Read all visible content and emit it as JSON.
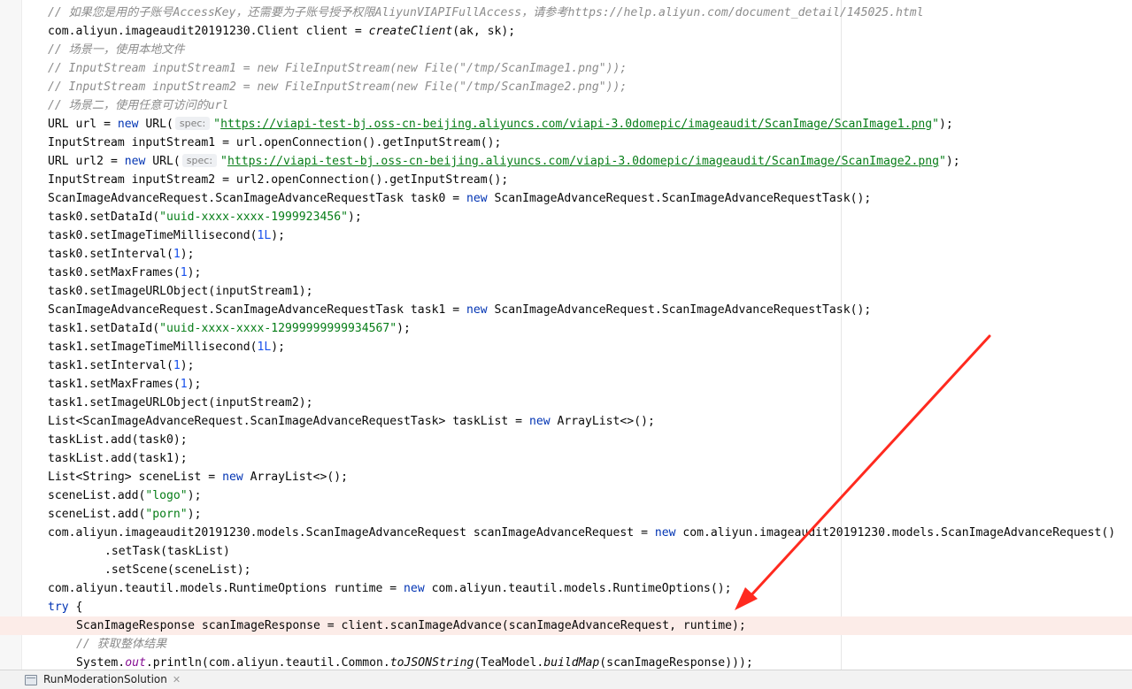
{
  "editor": {
    "lines": {
      "l0": {
        "comment": "// 如果您是用的子账号AccessKey，还需要为子账号授予权限AliyunVIAPIFullAccess，请参考https://help.aliyun.com/document_detail/145025.html"
      },
      "l1": {
        "prefix": "com.aliyun.imageaudit20191230.Client client = ",
        "method": "createClient",
        "suffix": "(ak, sk);"
      },
      "l2": {
        "comment": "// 场景一，使用本地文件"
      },
      "l3": {
        "comment": "// InputStream inputStream1 = new FileInputStream(new File(\"/tmp/ScanImage1.png\"));"
      },
      "l4": {
        "comment": "// InputStream inputStream2 = new FileInputStream(new File(\"/tmp/ScanImage2.png\"));"
      },
      "l5": {
        "comment": "// 场景二，使用任意可访问的url"
      },
      "l6": {
        "prefix": "URL url = ",
        "kw": "new",
        "mid": " URL(",
        "hint": "spec:",
        "q1": "\"",
        "url": "https://viapi-test-bj.oss-cn-beijing.aliyuncs.com/viapi-3.0domepic/imageaudit/ScanImage/ScanImage1.png",
        "q2": "\"",
        "suffix": ");"
      },
      "l7": {
        "text": "InputStream inputStream1 = url.openConnection().getInputStream();"
      },
      "l8": {
        "prefix": "URL url2 = ",
        "kw": "new",
        "mid": " URL(",
        "hint": "spec:",
        "q1": "\"",
        "url": "https://viapi-test-bj.oss-cn-beijing.aliyuncs.com/viapi-3.0domepic/imageaudit/ScanImage/ScanImage2.png",
        "q2": "\"",
        "suffix": ");"
      },
      "l9": {
        "text": "InputStream inputStream2 = url2.openConnection().getInputStream();"
      },
      "l10": {
        "prefix": "ScanImageAdvanceRequest.ScanImageAdvanceRequestTask task0 = ",
        "kw": "new",
        "suffix": " ScanImageAdvanceRequest.ScanImageAdvanceRequestTask();"
      },
      "l11": {
        "prefix": "task0.setDataId(",
        "str": "\"uuid-xxxx-xxxx-1999923456\"",
        "suffix": ");"
      },
      "l12": {
        "prefix": "task0.setImageTimeMillisecond(",
        "num": "1L",
        "suffix": ");"
      },
      "l13": {
        "prefix": "task0.setInterval(",
        "num": "1",
        "suffix": ");"
      },
      "l14": {
        "prefix": "task0.setMaxFrames(",
        "num": "1",
        "suffix": ");"
      },
      "l15": {
        "text": "task0.setImageURLObject(inputStream1);"
      },
      "l16": {
        "prefix": "ScanImageAdvanceRequest.ScanImageAdvanceRequestTask task1 = ",
        "kw": "new",
        "suffix": " ScanImageAdvanceRequest.ScanImageAdvanceRequestTask();"
      },
      "l17": {
        "prefix": "task1.setDataId(",
        "str": "\"uuid-xxxx-xxxx-12999999999934567\"",
        "suffix": ");"
      },
      "l18": {
        "prefix": "task1.setImageTimeMillisecond(",
        "num": "1L",
        "suffix": ");"
      },
      "l19": {
        "prefix": "task1.setInterval(",
        "num": "1",
        "suffix": ");"
      },
      "l20": {
        "prefix": "task1.setMaxFrames(",
        "num": "1",
        "suffix": ");"
      },
      "l21": {
        "text": "task1.setImageURLObject(inputStream2);"
      },
      "l22": {
        "prefix": "List<ScanImageAdvanceRequest.ScanImageAdvanceRequestTask> taskList = ",
        "kw": "new",
        "suffix": " ArrayList<>();"
      },
      "l23": {
        "text": "taskList.add(task0);"
      },
      "l24": {
        "text": "taskList.add(task1);"
      },
      "l25": {
        "prefix": "List<String> sceneList = ",
        "kw": "new",
        "suffix": " ArrayList<>();"
      },
      "l26": {
        "prefix": "sceneList.add(",
        "str": "\"logo\"",
        "suffix": ");"
      },
      "l27": {
        "prefix": "sceneList.add(",
        "str": "\"porn\"",
        "suffix": ");"
      },
      "l28": {
        "prefix": "com.aliyun.imageaudit20191230.models.ScanImageAdvanceRequest scanImageAdvanceRequest = ",
        "kw": "new",
        "suffix": " com.aliyun.imageaudit20191230.models.ScanImageAdvanceRequest()"
      },
      "l29": {
        "text": ".setTask(taskList)"
      },
      "l30": {
        "text": ".setScene(sceneList);"
      },
      "l31": {
        "prefix": "com.aliyun.teautil.models.RuntimeOptions runtime = ",
        "kw": "new",
        "suffix": " com.aliyun.teautil.models.RuntimeOptions();"
      },
      "l32": {
        "kw": "try",
        "suffix": " {"
      },
      "l33": {
        "text": "ScanImageResponse scanImageResponse = client.scanImageAdvance(scanImageAdvanceRequest, runtime);"
      },
      "l34": {
        "comment": "// 获取整体结果"
      },
      "l35": {
        "a": "System.",
        "field": "out",
        "b": ".println(com.aliyun.teautil.Common.",
        "m1": "toJSONString",
        "c": "(TeaModel.",
        "m2": "buildMap",
        "d": "(scanImageResponse)));"
      }
    }
  },
  "statusbar": {
    "run_tab_label": "RunModerationSolution",
    "close_glyph": "✕"
  },
  "colors": {
    "keyword": "#0033b3",
    "string": "#067d17",
    "number": "#1750eb",
    "comment": "#8c8c8c",
    "current_line": "#fcece8",
    "annotation_arrow": "#ff2a1f"
  },
  "icons": {
    "run_tab": "run-window-icon",
    "arrow": "annotation-arrow-icon"
  }
}
